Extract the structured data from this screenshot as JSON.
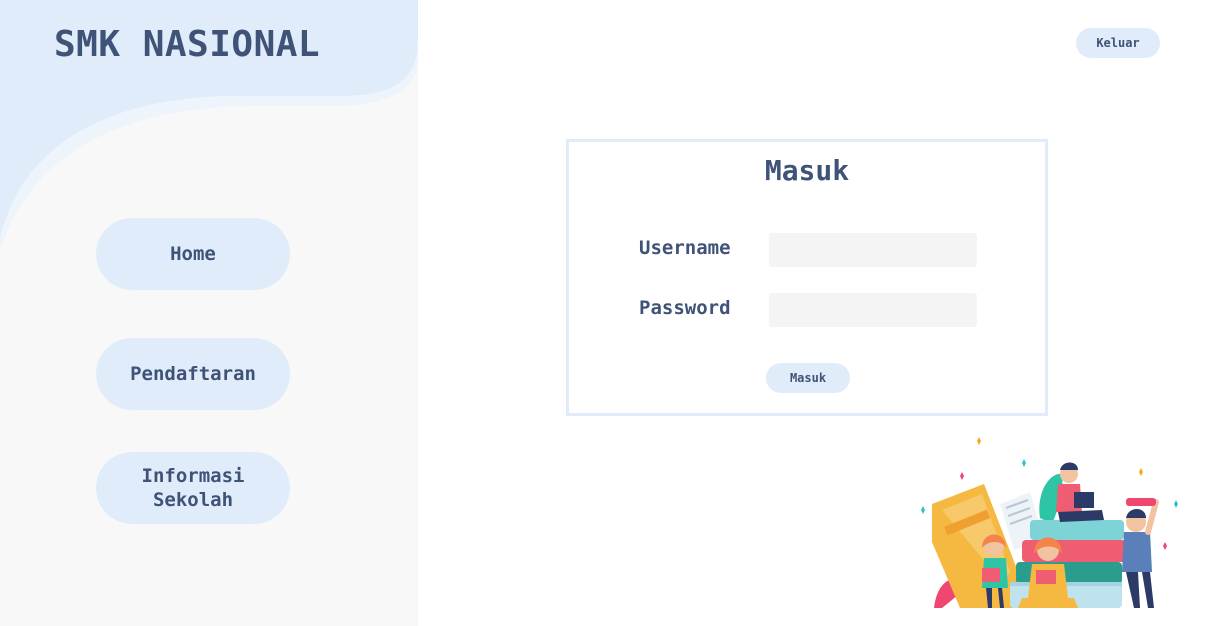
{
  "sidebar": {
    "brand": "SMK NASIONAL",
    "nav": [
      {
        "label": "Home"
      },
      {
        "label": "Pendaftaran"
      },
      {
        "label": "Informasi Sekolah"
      }
    ]
  },
  "header": {
    "logout_label": "Keluar"
  },
  "login": {
    "title": "Masuk",
    "username_label": "Username",
    "username_value": "",
    "password_label": "Password",
    "password_value": "",
    "submit_label": "Masuk"
  },
  "colors": {
    "primary_text": "#3f5277",
    "accent_light": "#e1ecfa",
    "sidebar_bg": "#f8f8f8"
  },
  "illustration": {
    "name": "students-with-books-illustration"
  }
}
